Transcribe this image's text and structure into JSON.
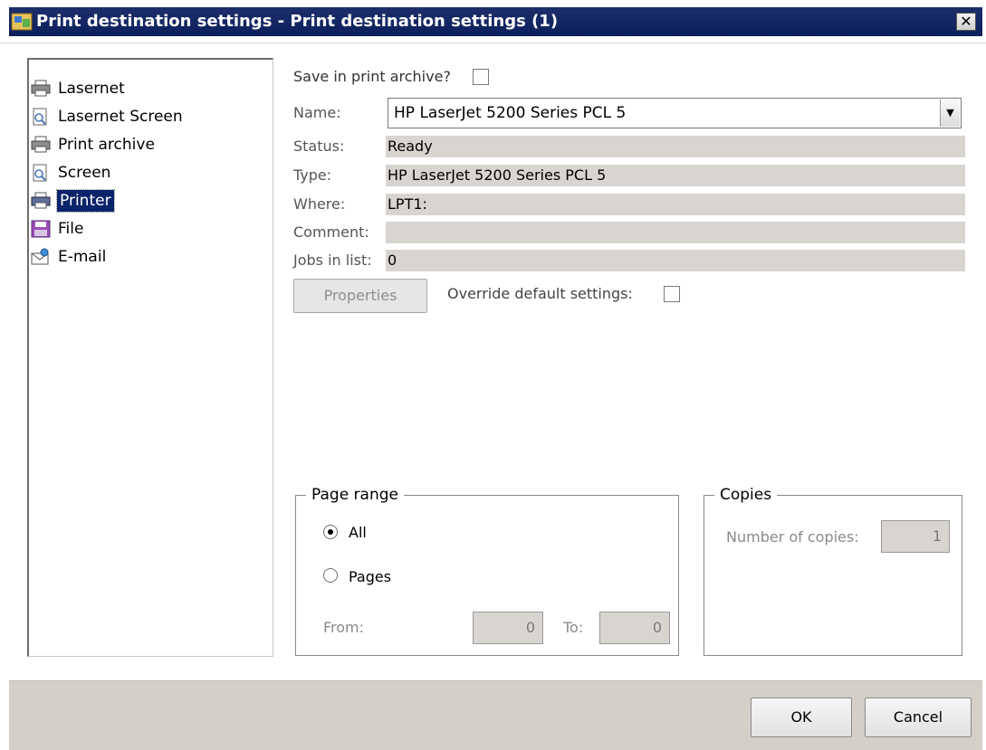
{
  "window": {
    "title": "Print destination settings - Print destination settings (1)",
    "close_glyph": "✕"
  },
  "tree": {
    "items": [
      {
        "label": "Lasernet",
        "icon": "printer-icon"
      },
      {
        "label": "Lasernet Screen",
        "icon": "screen-preview-icon"
      },
      {
        "label": "Print archive",
        "icon": "printer-icon"
      },
      {
        "label": "Screen",
        "icon": "screen-preview-icon"
      },
      {
        "label": "Printer",
        "icon": "printer-icon",
        "selected": true
      },
      {
        "label": "File",
        "icon": "floppy-disk-icon"
      },
      {
        "label": "E-mail",
        "icon": "email-icon"
      }
    ]
  },
  "form": {
    "save_archive_label": "Save in print archive?",
    "save_archive_checked": false,
    "name_label": "Name:",
    "name_value": "HP LaserJet 5200 Series PCL 5",
    "status_label": "Status:",
    "status_value": "Ready",
    "type_label": "Type:",
    "type_value": "HP LaserJet 5200 Series PCL 5",
    "where_label": "Where:",
    "where_value": "LPT1:",
    "comment_label": "Comment:",
    "comment_value": "",
    "jobs_label": "Jobs in list:",
    "jobs_value": "0",
    "properties_label": "Properties",
    "override_label": "Override default settings:",
    "override_checked": false
  },
  "page_range": {
    "legend": "Page range",
    "all_label": "All",
    "pages_label": "Pages",
    "from_label": "From:",
    "from_value": "0",
    "to_label": "To:",
    "to_value": "0",
    "selected": "All"
  },
  "copies": {
    "legend": "Copies",
    "number_label": "Number of copies:",
    "number_value": "1"
  },
  "footer": {
    "ok_label": "OK",
    "cancel_label": "Cancel"
  },
  "colors": {
    "titlebar": "#0c1f5c",
    "selection": "#0a246a",
    "readonly_field": "#d8d5d1",
    "footer": "#d4d0c8"
  }
}
